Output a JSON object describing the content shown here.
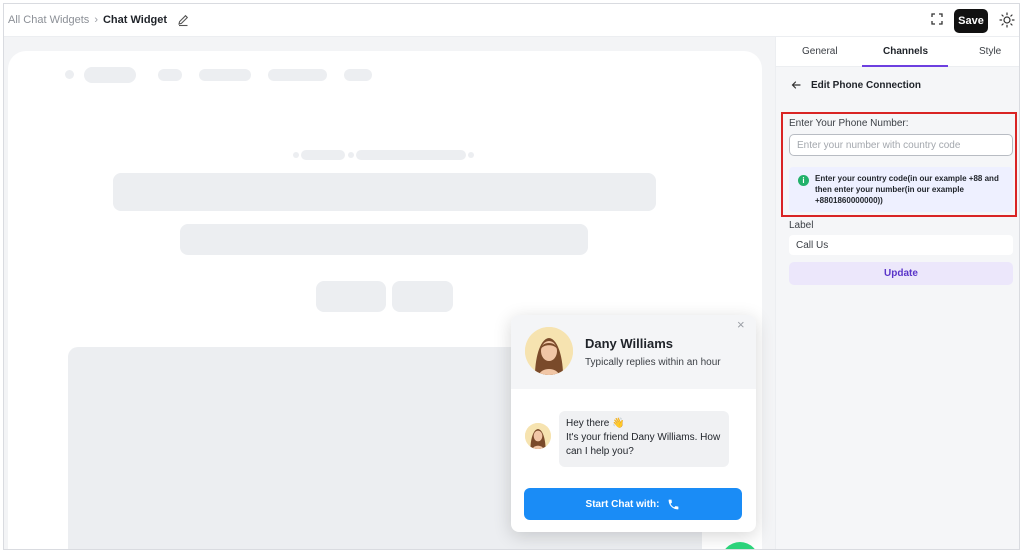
{
  "breadcrumb": {
    "parent": "All Chat Widgets",
    "separator": "›",
    "current": "Chat Widget"
  },
  "toolbar": {
    "save_label": "Save"
  },
  "tabs": [
    {
      "label": "General"
    },
    {
      "label": "Channels",
      "active": true
    },
    {
      "label": "Style"
    }
  ],
  "panel": {
    "title": "Edit Phone Connection",
    "phone_label": "Enter Your Phone Number:",
    "phone_placeholder": "Enter your number with country code",
    "phone_value": "",
    "info_text": "Enter your country code(in our example +88 and then enter your number(in our example +8801860000000))",
    "label_title": "Label",
    "label_value": "Call Us",
    "update_label": "Update"
  },
  "chat_popup": {
    "agent_name": "Dany Williams",
    "agent_status": "Typically replies within an hour",
    "close_glyph": "×",
    "greeting": "Hey there 👋",
    "message": "It's your friend Dany Williams. How can I help you?",
    "start_button_label": "Start Chat with:"
  },
  "colors": {
    "accent": "#6d3fe0",
    "start_button": "#1a8cf6",
    "phone_fab": "#2bd37a",
    "highlight_border": "#d92424",
    "save_button": "#111111"
  },
  "icons": [
    "edit-icon",
    "expand-icon",
    "sun-icon",
    "arrow-left-icon",
    "info-icon",
    "close-icon",
    "phone-icon"
  ]
}
